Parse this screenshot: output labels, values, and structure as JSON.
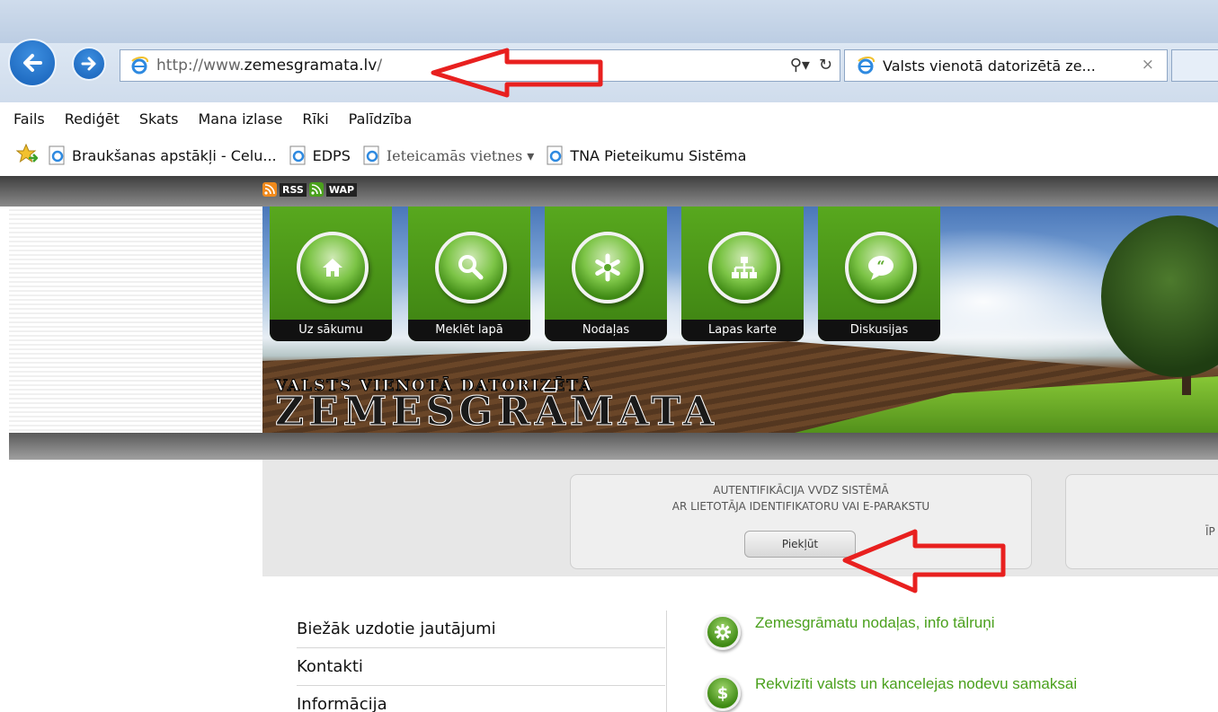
{
  "browser": {
    "address_url_prefix": "http://www.",
    "address_url_domain": "zemesgramata.lv",
    "address_url_suffix": "/",
    "tab_title": "Valsts vienotā datorizētā ze...",
    "tab_close": "×",
    "search_icon": "search-icon",
    "refresh_icon": "refresh-icon",
    "menu": [
      "Fails",
      "Rediģēt",
      "Skats",
      "Mana izlase",
      "Rīki",
      "Palīdzība"
    ],
    "favorites": [
      {
        "label": "Braukšanas apstākļi - Celu..."
      },
      {
        "label": "EDPS"
      },
      {
        "label": "Ieteicamās vietnes ▾"
      },
      {
        "label": "TNA Pieteikumu Sistēma"
      }
    ]
  },
  "site": {
    "rss": "RSS",
    "wap": "WAP",
    "tiles": [
      {
        "label": "Uz sākumu",
        "icon": "home-icon"
      },
      {
        "label": "Meklēt lapā",
        "icon": "magnifier-icon"
      },
      {
        "label": "Nodaļas",
        "icon": "asterisk-icon"
      },
      {
        "label": "Lapas karte",
        "icon": "sitemap-icon"
      },
      {
        "label": "Diskusijas",
        "icon": "quote-bubble-icon"
      }
    ],
    "logo_top": "VALSTS VIENOTĀ DATORIZĒTĀ",
    "logo_main": "ZEMESGRĀMATA",
    "auth": {
      "line1": "AUTENTIFIKĀCIJA VVDZ SISTĒMĀ",
      "line2": "AR LIETOTĀJA IDENTIFIKATORU VAI E-PARAKSTU",
      "button": "Piekļūt"
    },
    "auth2_partial": "ĪP",
    "left_nav": [
      "Biežāk uzdotie jautājumi",
      "Kontakti",
      "Informācija"
    ],
    "links": [
      {
        "label": "Zemesgrāmatu nodaļas, info tālruņi",
        "icon": "gear-icon"
      },
      {
        "label": "Rekvizīti valsts un kancelejas nodevu samaksai",
        "icon": "dollar-icon"
      }
    ]
  },
  "colors": {
    "arrow": "#e8201f",
    "link_green": "#4aa01c",
    "tile_green": "#4a9a18"
  }
}
